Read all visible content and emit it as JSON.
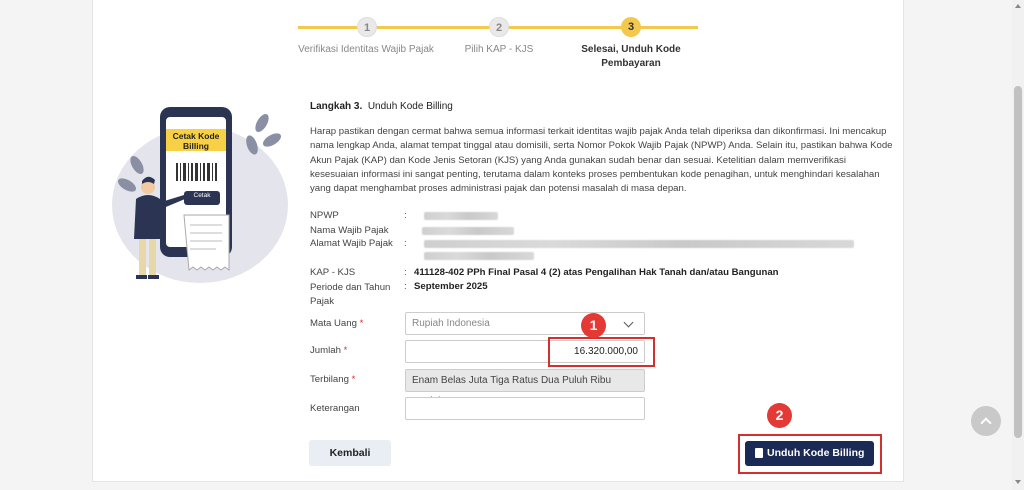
{
  "stepper": {
    "steps": [
      {
        "number": "1",
        "label": "Verifikasi Identitas Wajib Pajak"
      },
      {
        "number": "2",
        "label": "Pilih KAP - KJS"
      },
      {
        "number": "3",
        "label_line1": "Selesai, Unduh Kode",
        "label_line2": "Pembayaran"
      }
    ],
    "colors": {
      "done": "#e9e9e9",
      "active": "#f2c94c"
    }
  },
  "illustration": {
    "card_title_line1": "Cetak Kode",
    "card_title_line2": "Billing",
    "button_label": "Cetak"
  },
  "content": {
    "step_title_bold": "Langkah 3.",
    "step_title": "Unduh Kode Billing",
    "paragraph": "Harap pastikan dengan cermat bahwa semua informasi terkait identitas wajib pajak Anda telah diperiksa dan dikonfirmasi. Ini mencakup nama lengkap Anda, alamat tempat tinggal atau domisili, serta Nomor Pokok Wajib Pajak (NPWP) Anda. Selain itu, pastikan bahwa Kode Akun Pajak (KAP) dan Kode Jenis Setoran (KJS) yang Anda gunakan sudah benar dan sesuai. Ketelitian dalam memverifikasi kesesuaian informasi ini sangat penting, terutama dalam konteks proses pembentukan kode penagihan, untuk menghindari kesalahan yang dapat menghambat proses administrasi pajak dan potensi masalah di masa depan."
  },
  "info": {
    "npwp_label": "NPWP",
    "nama_label": "Nama Wajib Pajak",
    "alamat_label": "Alamat Wajib Pajak",
    "kap_label": "KAP - KJS",
    "kap_value": "411128-402 PPh Final Pasal 4 (2) atas Pengalihan Hak Tanah dan/atau Bangunan",
    "periode_label_line1": "Periode dan Tahun",
    "periode_label_line2": "Pajak",
    "periode_value": "September 2025",
    "colon": ":"
  },
  "form": {
    "mata_uang_label": "Mata Uang",
    "mata_uang_value": "Rupiah Indonesia",
    "jumlah_label": "Jumlah",
    "jumlah_value": "16.320.000,00",
    "terbilang_label": "Terbilang",
    "terbilang_value": "Enam Belas Juta Tiga Ratus Dua Puluh Ribu Rupiah",
    "keterangan_label": "Keterangan",
    "keterangan_value": "",
    "required_mark": "*"
  },
  "annotations": {
    "badge1": "1",
    "badge2": "2",
    "highlight_color": "#d32f2f"
  },
  "buttons": {
    "back": "Kembali",
    "download": "Unduh Kode Billing"
  }
}
